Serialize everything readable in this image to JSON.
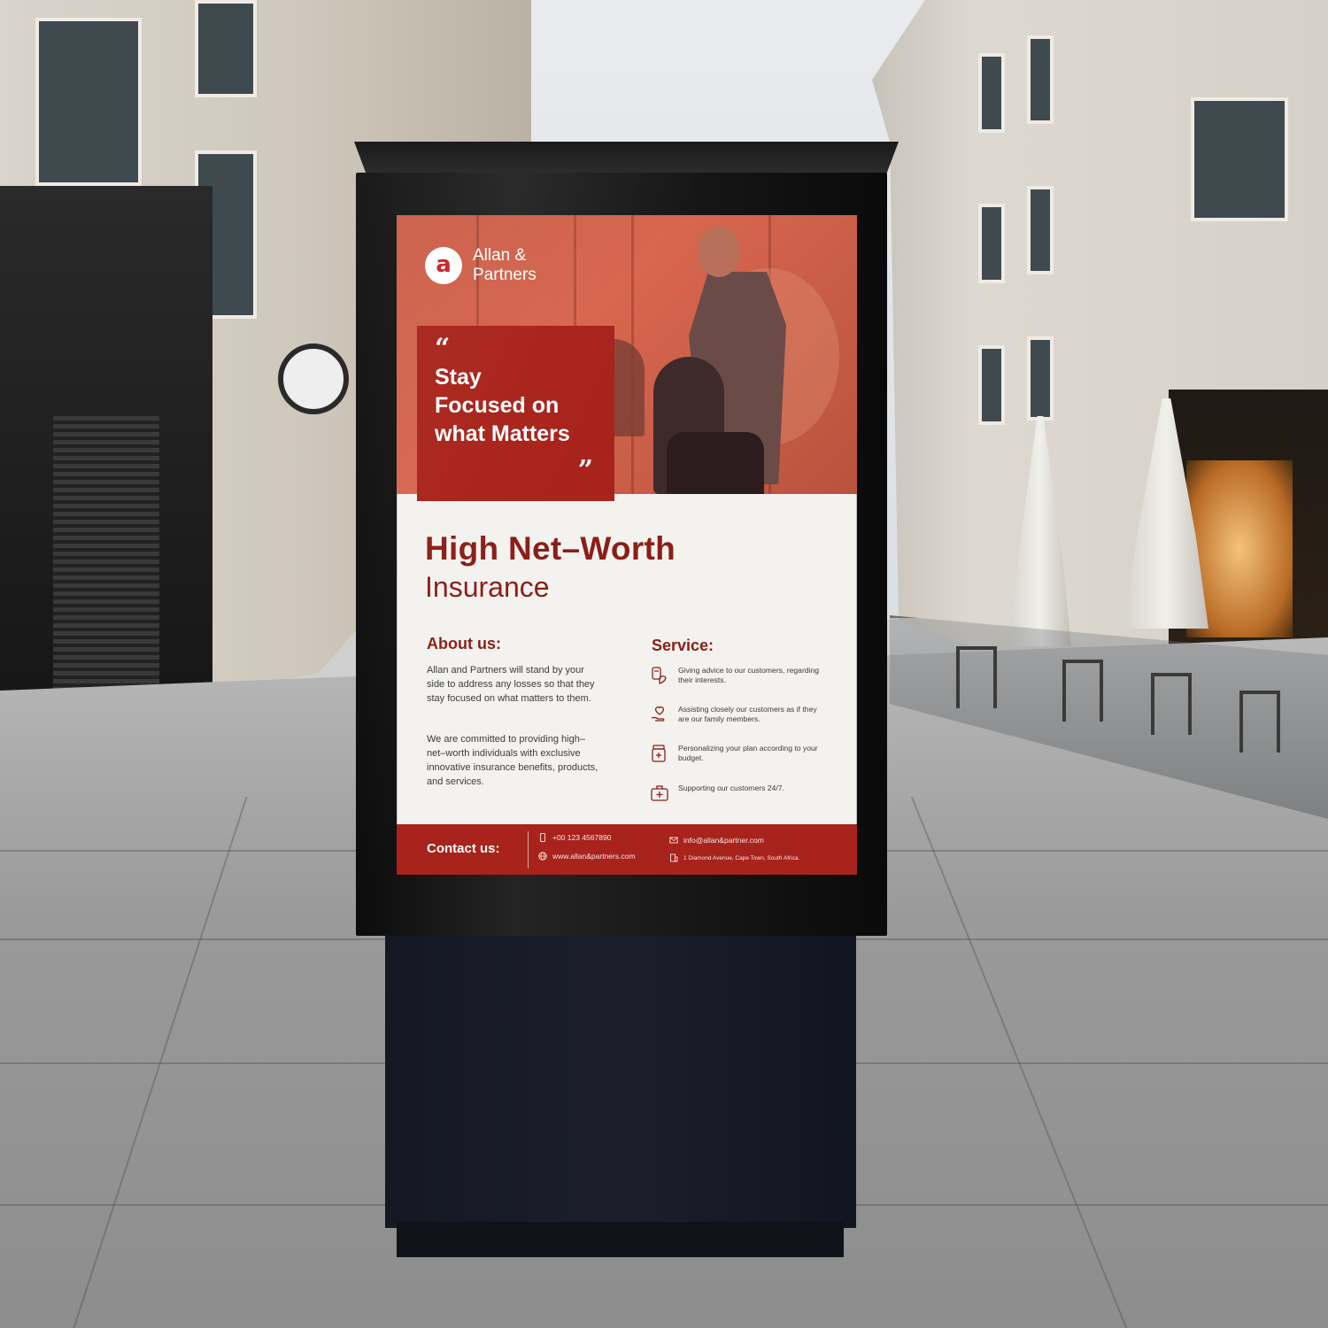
{
  "poster": {
    "brand": {
      "mark": "a",
      "line1": "Allan &",
      "line2": "Partners"
    },
    "quote": {
      "open": "“",
      "lines": [
        "Stay",
        "Focused on",
        "what Matters"
      ],
      "close": "”"
    },
    "headline": "High Net–Worth",
    "subheadline": "Insurance",
    "about": {
      "title": "About us:",
      "paragraphs": [
        "Allan and Partners will stand by your side to address any losses so that they stay focused on what matters to them.",
        "We are committed to providing high–net–worth individuals with exclusive innovative insurance benefits, products, and services."
      ]
    },
    "service": {
      "title": "Service:",
      "items": [
        {
          "icon": "advice-icon",
          "text": "Giving advice to our customers, regarding their interests."
        },
        {
          "icon": "heart-hand-icon",
          "text": "Assisting closely our customers as if they are our family members."
        },
        {
          "icon": "plan-jar-icon",
          "text": "Personalizing your plan according to your budget."
        },
        {
          "icon": "first-aid-kit-icon",
          "text": "Supporting our customers 24/7."
        }
      ]
    },
    "contact": {
      "title": "Contact us:",
      "phone": "+00 123 4567890",
      "website": "www.allan&partners.com",
      "email": "info@allan&partner.com",
      "address": "1 Diamond Avenue, Cape Town, South Africa."
    }
  },
  "colors": {
    "brand_red": "#a8231b",
    "heading_red": "#8a1f18",
    "photo_tint": "#c95c47"
  }
}
